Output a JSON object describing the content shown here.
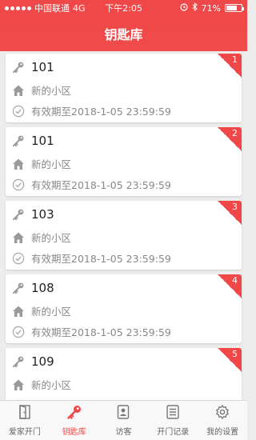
{
  "status_bar": {
    "carrier": "中国联通",
    "network": "4G",
    "time": "下午2:05",
    "battery": "71%",
    "battery_level": 0.71,
    "signal_filled": 5
  },
  "nav": {
    "title": "钥匙库"
  },
  "colors": {
    "accent": "#f04848",
    "text": "#222222",
    "muted": "#888888"
  },
  "keys": [
    {
      "badge": "1",
      "name": "101",
      "community": "新的小区",
      "validity": "有效期至2018-1-05 23:59:59"
    },
    {
      "badge": "2",
      "name": "101",
      "community": "新的小区",
      "validity": "有效期至2018-1-05 23:59:59"
    },
    {
      "badge": "3",
      "name": "103",
      "community": "新的小区",
      "validity": "有效期至2018-1-05 23:59:59"
    },
    {
      "badge": "4",
      "name": "108",
      "community": "新的小区",
      "validity": "有效期至2018-1-05 23:59:59"
    },
    {
      "badge": "5",
      "name": "109",
      "community": "新的小区",
      "validity": "有效期至2018-1-05 23:59:59"
    }
  ],
  "tabs": [
    {
      "label": "爱家开门",
      "icon": "door-icon",
      "active": false
    },
    {
      "label": "钥匙库",
      "icon": "key-icon",
      "active": true
    },
    {
      "label": "访客",
      "icon": "visitor-icon",
      "active": false
    },
    {
      "label": "开门记录",
      "icon": "record-icon",
      "active": false
    },
    {
      "label": "我的设置",
      "icon": "gear-icon",
      "active": false
    }
  ]
}
